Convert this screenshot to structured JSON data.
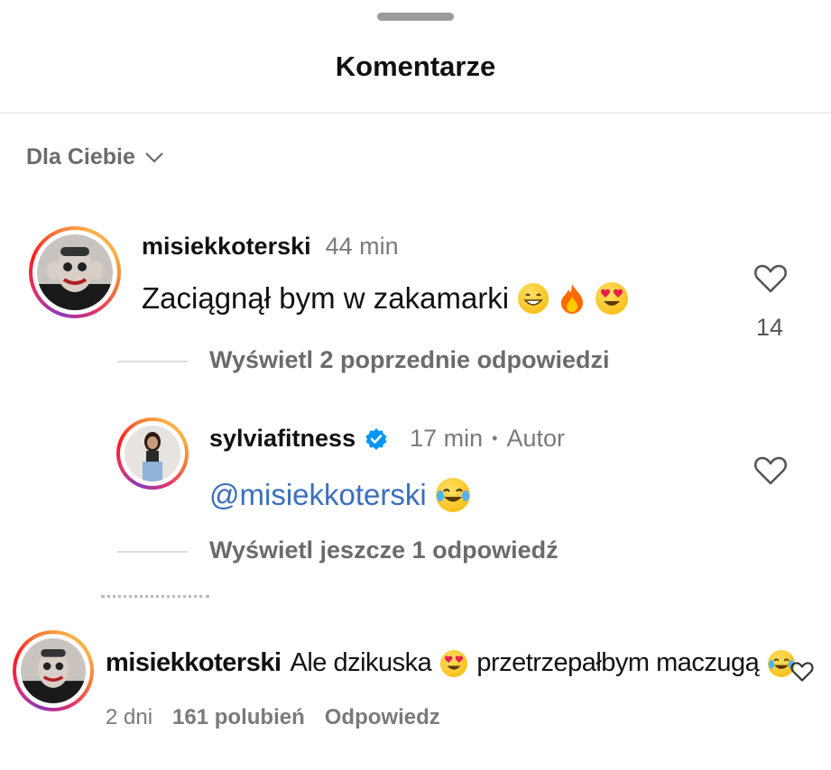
{
  "sheet": {
    "title": "Komentarze"
  },
  "sort": {
    "label": "Dla Ciebie"
  },
  "comments": [
    {
      "username": "misiekkoterski",
      "time": "44 min",
      "text": "Zaciągnął bym w zakamarki",
      "emojis": [
        "grinning-face",
        "fire",
        "heart-eyes"
      ],
      "likes": "14",
      "view_replies": "Wyświetl 2 poprzednie odpowiedzi"
    },
    {
      "username": "sylviafitness",
      "verified": true,
      "time": "17 min",
      "separator": "•",
      "author_tag": "Autor",
      "mention": "@misiekkoterski",
      "emojis": [
        "tears-of-joy"
      ],
      "view_more": "Wyświetl jeszcze 1 odpowiedź"
    },
    {
      "username": "misiekkoterski",
      "text_part1": "Ale dzikuska",
      "text_part2": "przetrzepałbym maczugą",
      "emojis": [
        "heart-eyes",
        "tears-of-joy"
      ],
      "time": "2 dni",
      "likes_label": "161 polubień",
      "reply_label": "Odpowiedz"
    }
  ],
  "colors": {
    "mention": "#3a6fbf",
    "verified": "#0095f6",
    "fire": "#ff6a00",
    "muted": "#7a7a7a"
  }
}
